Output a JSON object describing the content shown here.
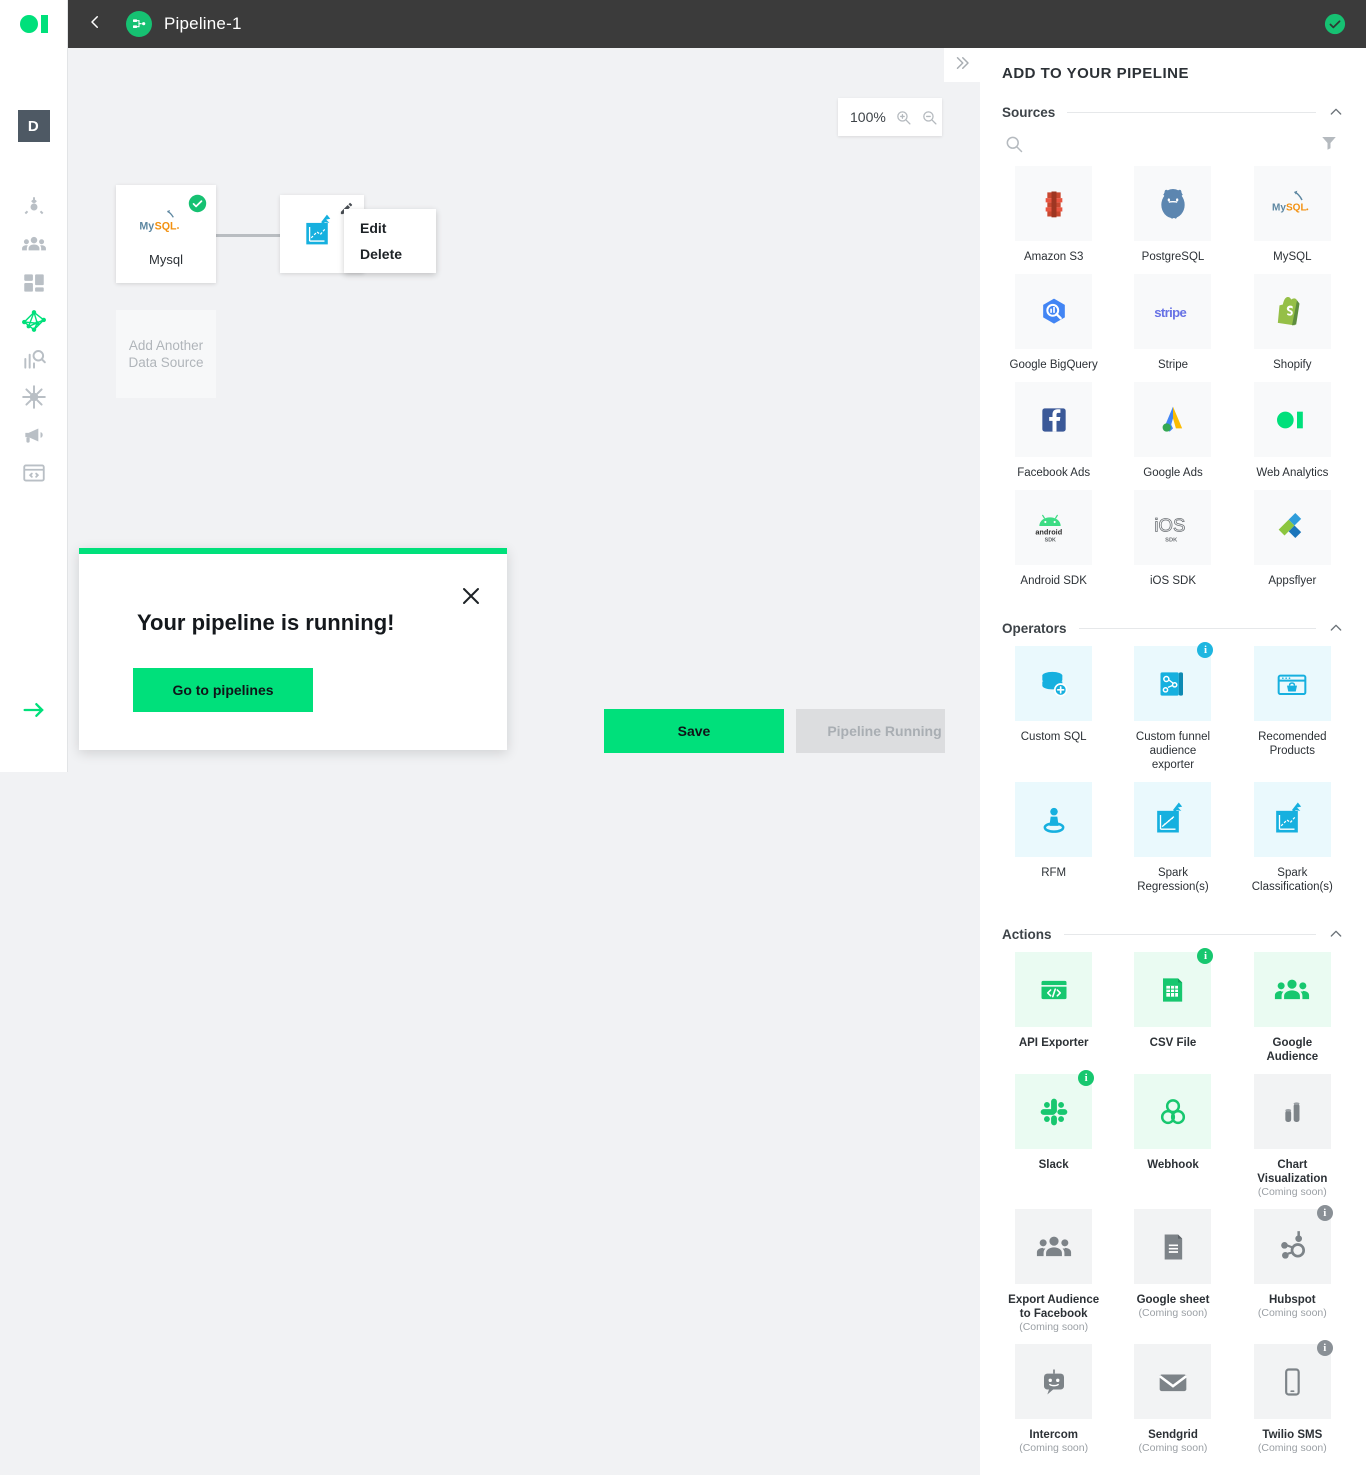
{
  "brand": {
    "logo_icon": "web-analytics-logo",
    "accent": "#00e07b"
  },
  "sidebar": {
    "avatar_initial": "D",
    "items": [
      {
        "icon": "user-import-icon",
        "active": false
      },
      {
        "icon": "audience-people-icon",
        "active": false
      },
      {
        "icon": "dashboard-grid-icon",
        "active": false
      },
      {
        "icon": "pipeline-network-icon",
        "active": true
      },
      {
        "icon": "analytics-search-icon",
        "active": false
      },
      {
        "icon": "snowflake-data-icon",
        "active": false
      },
      {
        "icon": "megaphone-campaign-icon",
        "active": false
      },
      {
        "icon": "code-window-icon",
        "active": false
      }
    ],
    "next_icon": "arrow-right-icon"
  },
  "header": {
    "back_icon": "chevron-left-icon",
    "pipeline_icon": "pipeline-node-icon",
    "title": "Pipeline-1",
    "status_icon": "check-circle-icon"
  },
  "canvas": {
    "zoom": {
      "level": "100%",
      "zoom_in_icon": "zoom-in-icon",
      "zoom_out_icon": "zoom-out-icon"
    },
    "nodes": [
      {
        "id": "mysql",
        "label": "Mysql",
        "icon": "mysql-logo",
        "status_icon": "check-circle-icon"
      },
      {
        "id": "spark",
        "label": "",
        "icon": "spark-classification-icon",
        "edit_icon": "pencil-icon"
      }
    ],
    "add_source": {
      "label": "Add Another\nData Source",
      "line1": "Add Another",
      "line2": "Data Source"
    },
    "context_menu": {
      "items": [
        {
          "label": "Edit"
        },
        {
          "label": "Delete"
        }
      ]
    },
    "buttons": {
      "save_label": "Save",
      "running_label": "Pipeline Running"
    }
  },
  "modal": {
    "title": "Your pipeline is running!",
    "action_label": "Go to pipelines",
    "close_icon": "close-icon",
    "accent": "#00e07b"
  },
  "panel": {
    "title": "ADD TO YOUR PIPELINE",
    "collapse_icon": "chevron-double-right-icon",
    "search_icon": "search-icon",
    "filter_icon": "filter-icon",
    "sections": [
      {
        "name": "Sources",
        "chevron_icon": "chevron-up-icon",
        "tile_style": "src",
        "tiles": [
          {
            "label": "Amazon S3",
            "icon": "amazon-s3-logo"
          },
          {
            "label": "PostgreSQL",
            "icon": "postgresql-logo"
          },
          {
            "label": "MySQL",
            "icon": "mysql-logo"
          },
          {
            "label": "Google BigQuery",
            "icon": "google-bigquery-logo"
          },
          {
            "label": "Stripe",
            "icon": "stripe-logo"
          },
          {
            "label": "Shopify",
            "icon": "shopify-logo"
          },
          {
            "label": "Facebook Ads",
            "icon": "facebook-ads-logo"
          },
          {
            "label": "Google Ads",
            "icon": "google-ads-logo"
          },
          {
            "label": "Web Analytics",
            "icon": "web-analytics-logo"
          },
          {
            "label": "Android SDK",
            "icon": "android-sdk-logo"
          },
          {
            "label": "iOS SDK",
            "icon": "ios-sdk-logo"
          },
          {
            "label": "Appsflyer",
            "icon": "appsflyer-logo"
          }
        ]
      },
      {
        "name": "Operators",
        "chevron_icon": "chevron-up-icon",
        "tile_style": "op",
        "tiles": [
          {
            "label": "Custom SQL",
            "icon": "database-add-icon"
          },
          {
            "label": "Custom funnel audience exporter",
            "icon": "funnel-blueprint-icon",
            "badge": "i"
          },
          {
            "label": "Recomended Products",
            "icon": "recommended-products-icon"
          },
          {
            "label": "RFM",
            "icon": "rfm-person-icon"
          },
          {
            "label": "Spark Regression(s)",
            "icon": "spark-regression-icon"
          },
          {
            "label": "Spark Classification(s)",
            "icon": "spark-classification-icon"
          }
        ]
      },
      {
        "name": "Actions",
        "chevron_icon": "chevron-up-icon",
        "tile_style": "act",
        "tiles": [
          {
            "label": "API Exporter",
            "icon": "api-code-icon"
          },
          {
            "label": "CSV File",
            "icon": "csv-file-icon",
            "badge": "i"
          },
          {
            "label": "Google Audience",
            "icon": "audience-people-icon"
          },
          {
            "label": "Slack",
            "icon": "slack-logo",
            "badge": "i"
          },
          {
            "label": "Webhook",
            "icon": "webhook-logo"
          },
          {
            "label": "Chart Visualization",
            "icon": "chart-bars-icon",
            "coming_soon": "(Coming soon)"
          },
          {
            "label": "Export Audience to Facebook",
            "icon": "audience-people-icon",
            "coming_soon": "(Coming soon)"
          },
          {
            "label": "Google sheet",
            "icon": "document-icon",
            "coming_soon": "(Coming soon)"
          },
          {
            "label": "Hubspot",
            "icon": "hubspot-logo",
            "badge": "i",
            "coming_soon": "(Coming soon)"
          },
          {
            "label": "Intercom",
            "icon": "intercom-logo",
            "coming_soon": "(Coming soon)"
          },
          {
            "label": "Sendgrid",
            "icon": "envelope-icon",
            "coming_soon": "(Coming soon)"
          },
          {
            "label": "Twilio SMS",
            "icon": "mobile-phone-icon",
            "badge": "i",
            "coming_soon": "(Coming soon)"
          }
        ]
      }
    ]
  }
}
